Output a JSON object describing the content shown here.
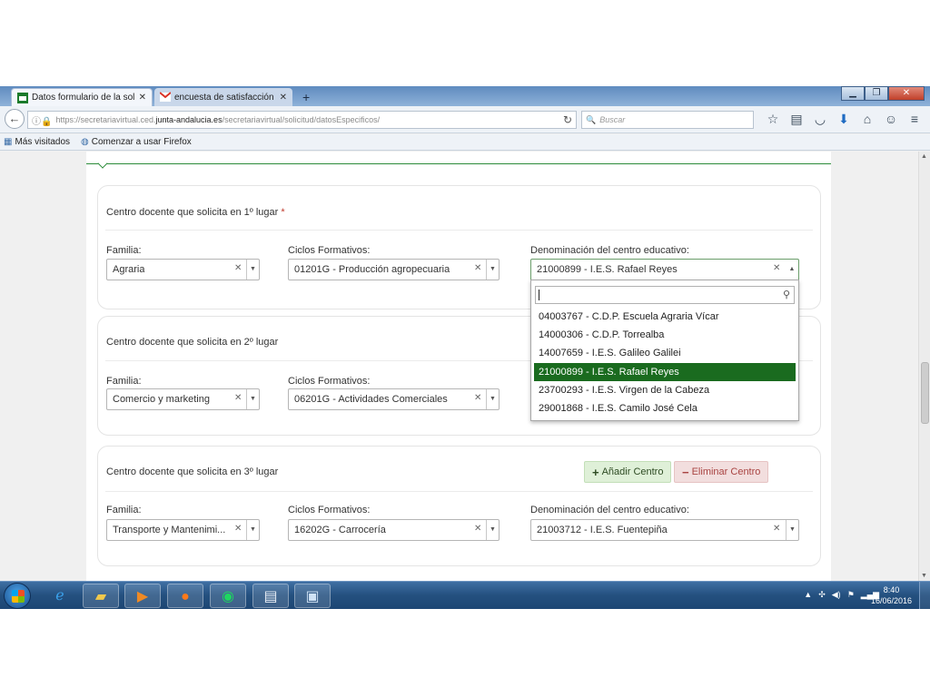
{
  "browser": {
    "tabs": [
      {
        "title": "Datos formulario de la soli...",
        "favicon": "junta-andalucia-icon"
      },
      {
        "title": "encuesta de satisfacción d...",
        "favicon": "gmail-icon"
      }
    ],
    "url": {
      "prefix": "https://secretariavirtual.ced.",
      "domain": "junta-andalucia.es",
      "path": "/secretariavirtual/solicitud/datosEspecificos/"
    },
    "search_placeholder": "Buscar",
    "bookmarks": [
      "Más visitados",
      "Comenzar a usar Firefox"
    ]
  },
  "form": {
    "sections": [
      {
        "title": "Centro docente que solicita en 1º lugar",
        "required_mark": "*",
        "familia_label": "Familia:",
        "familia": "Agraria",
        "ciclos_label": "Ciclos Formativos:",
        "ciclos": "01201G - Producción agropecuaria",
        "centro_label": "Denominación del centro educativo:",
        "centro": "21000899 - I.E.S. Rafael Reyes"
      },
      {
        "title": "Centro docente que solicita en 2º lugar",
        "familia_label": "Familia:",
        "familia": "Comercio y marketing",
        "ciclos_label": "Ciclos Formativos:",
        "ciclos": "06201G - Actividades Comerciales"
      },
      {
        "title": "Centro docente que solicita en 3º lugar",
        "familia_label": "Familia:",
        "familia": "Transporte y Mantenimi...",
        "ciclos_label": "Ciclos Formativos:",
        "ciclos": "16202G - Carrocería",
        "centro_label": "Denominación del centro educativo:",
        "centro": "21003712 - I.E.S. Fuentepiña"
      }
    ],
    "add_button": "Añadir Centro",
    "remove_button": "Eliminar Centro"
  },
  "dropdown": {
    "options": [
      "04003767 - C.D.P. Escuela Agraria Vícar",
      "14000306 - C.D.P. Torrealba",
      "14007659 - I.E.S. Galileo Galilei",
      "21000899 - I.E.S. Rafael Reyes",
      "23700293 - I.E.S. Virgen de la Cabeza",
      "29001868 - I.E.S. Camilo José Cela"
    ],
    "selected_index": 3,
    "highlight_color": "#1a6b1f"
  },
  "taskbar": {
    "time": "8:40",
    "date": "16/06/2016"
  }
}
